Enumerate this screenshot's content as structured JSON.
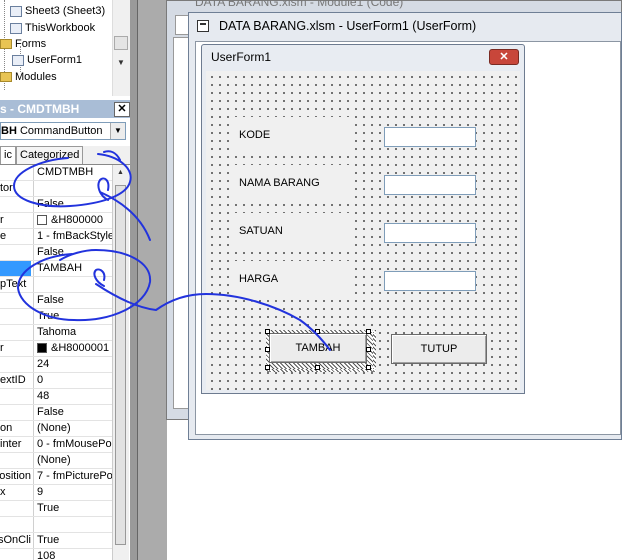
{
  "project_explorer": {
    "items": [
      {
        "label": "Sheet3 (Sheet3)",
        "icon": "sheet-icon"
      },
      {
        "label": "ThisWorkbook",
        "icon": "workbook-icon"
      },
      {
        "label": "Forms",
        "icon": "folder-icon"
      },
      {
        "label": "UserForm1",
        "icon": "userform-icon"
      },
      {
        "label": "Modules",
        "icon": "folder-icon"
      }
    ]
  },
  "properties": {
    "title": "s - CMDTMBH",
    "object_combo_bold": "BH",
    "object_combo_type": " CommandButton",
    "tabs": [
      "ic",
      "Categorized"
    ],
    "rows": [
      {
        "name": "",
        "value": "CMDTMBH"
      },
      {
        "name": "tor",
        "value": ""
      },
      {
        "name": "",
        "value": "False"
      },
      {
        "name": "r",
        "value": "&H800000",
        "swatch": "#ffffff"
      },
      {
        "name": "e",
        "value": "1 - fmBackStyle"
      },
      {
        "name": "",
        "value": "False"
      },
      {
        "name": "",
        "value": "TAMBAH",
        "selected": true
      },
      {
        "name": "pText",
        "value": ""
      },
      {
        "name": "",
        "value": "False"
      },
      {
        "name": "",
        "value": "True"
      },
      {
        "name": "",
        "value": "Tahoma"
      },
      {
        "name": "r",
        "value": "&H8000001",
        "swatch": "#000000"
      },
      {
        "name": "",
        "value": "24"
      },
      {
        "name": "extID",
        "value": "0"
      },
      {
        "name": "",
        "value": "48"
      },
      {
        "name": "",
        "value": "False"
      },
      {
        "name": "on",
        "value": "(None)"
      },
      {
        "name": "inter",
        "value": "0 - fmMousePo"
      },
      {
        "name": "",
        "value": "(None)"
      },
      {
        "name": "osition",
        "value": "7 - fmPicturePo"
      },
      {
        "name": "x",
        "value": "9"
      },
      {
        "name": "",
        "value": "True"
      },
      {
        "name": "",
        "value": ""
      },
      {
        "name": "usOnCli",
        "value": "True"
      },
      {
        "name": "",
        "value": "108"
      }
    ]
  },
  "code_window": {
    "title": "DATA BARANG.xlsm - Module1 (Code)"
  },
  "userform_window": {
    "title": "DATA BARANG.xlsm - UserForm1 (UserForm)"
  },
  "userform": {
    "caption": "UserForm1",
    "close_glyph": "✕",
    "fields": [
      {
        "label": "KODE",
        "value": ""
      },
      {
        "label": "NAMA BARANG",
        "value": ""
      },
      {
        "label": "SATUAN",
        "value": ""
      },
      {
        "label": "HARGA",
        "value": ""
      }
    ],
    "buttons": {
      "add": "TAMBAH",
      "close": "TUTUP"
    }
  },
  "colors": {
    "properties_title_bg": "#a9bdd6",
    "selection_highlight": "#3399ff",
    "annotation_ink": "#2233dd",
    "form_close_button": "#c8463a"
  }
}
